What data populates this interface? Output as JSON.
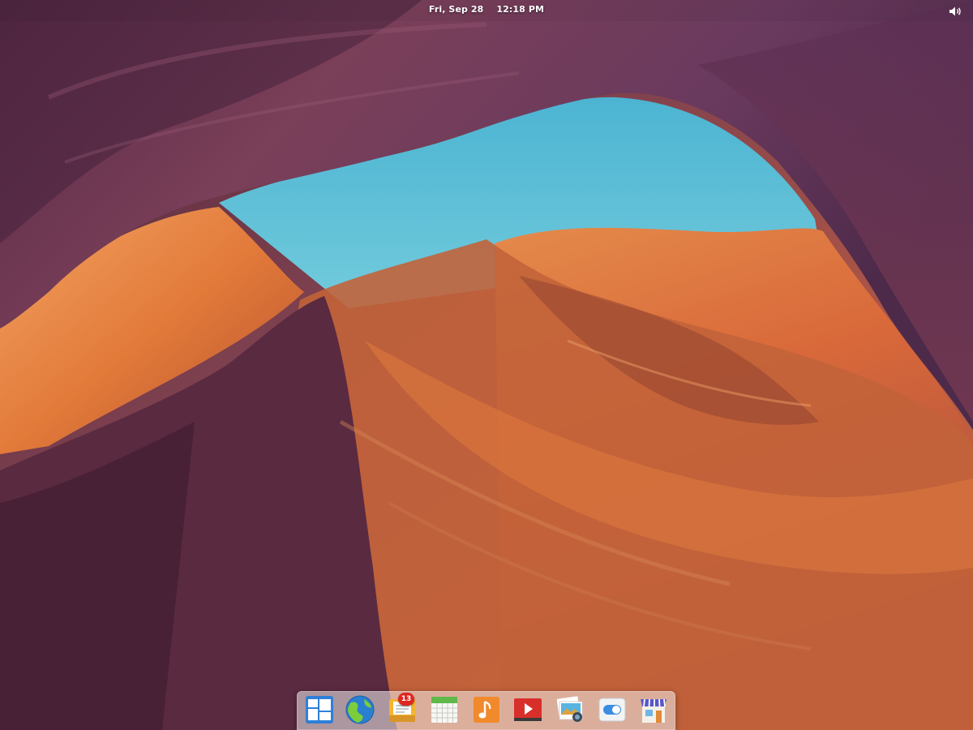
{
  "panel": {
    "date": "Fri, Sep 28",
    "time": "12:18 PM",
    "volume_icon": "volume-icon"
  },
  "dock": {
    "items": [
      {
        "name": "multitasking-view",
        "icon": "multitasking-view-icon"
      },
      {
        "name": "web-browser",
        "icon": "globe-icon"
      },
      {
        "name": "mail",
        "icon": "mail-icon",
        "badge": "13"
      },
      {
        "name": "calendar",
        "icon": "calendar-icon"
      },
      {
        "name": "music",
        "icon": "music-note-icon"
      },
      {
        "name": "videos",
        "icon": "video-play-icon"
      },
      {
        "name": "photos",
        "icon": "photos-icon"
      },
      {
        "name": "system-settings",
        "icon": "toggle-switch-icon"
      },
      {
        "name": "app-center",
        "icon": "store-icon"
      }
    ]
  },
  "colors": {
    "sky": "#5cc0d6",
    "rock_purple": "#6e3a57",
    "rock_orange": "#e0762f",
    "badge": "#e0271f"
  }
}
